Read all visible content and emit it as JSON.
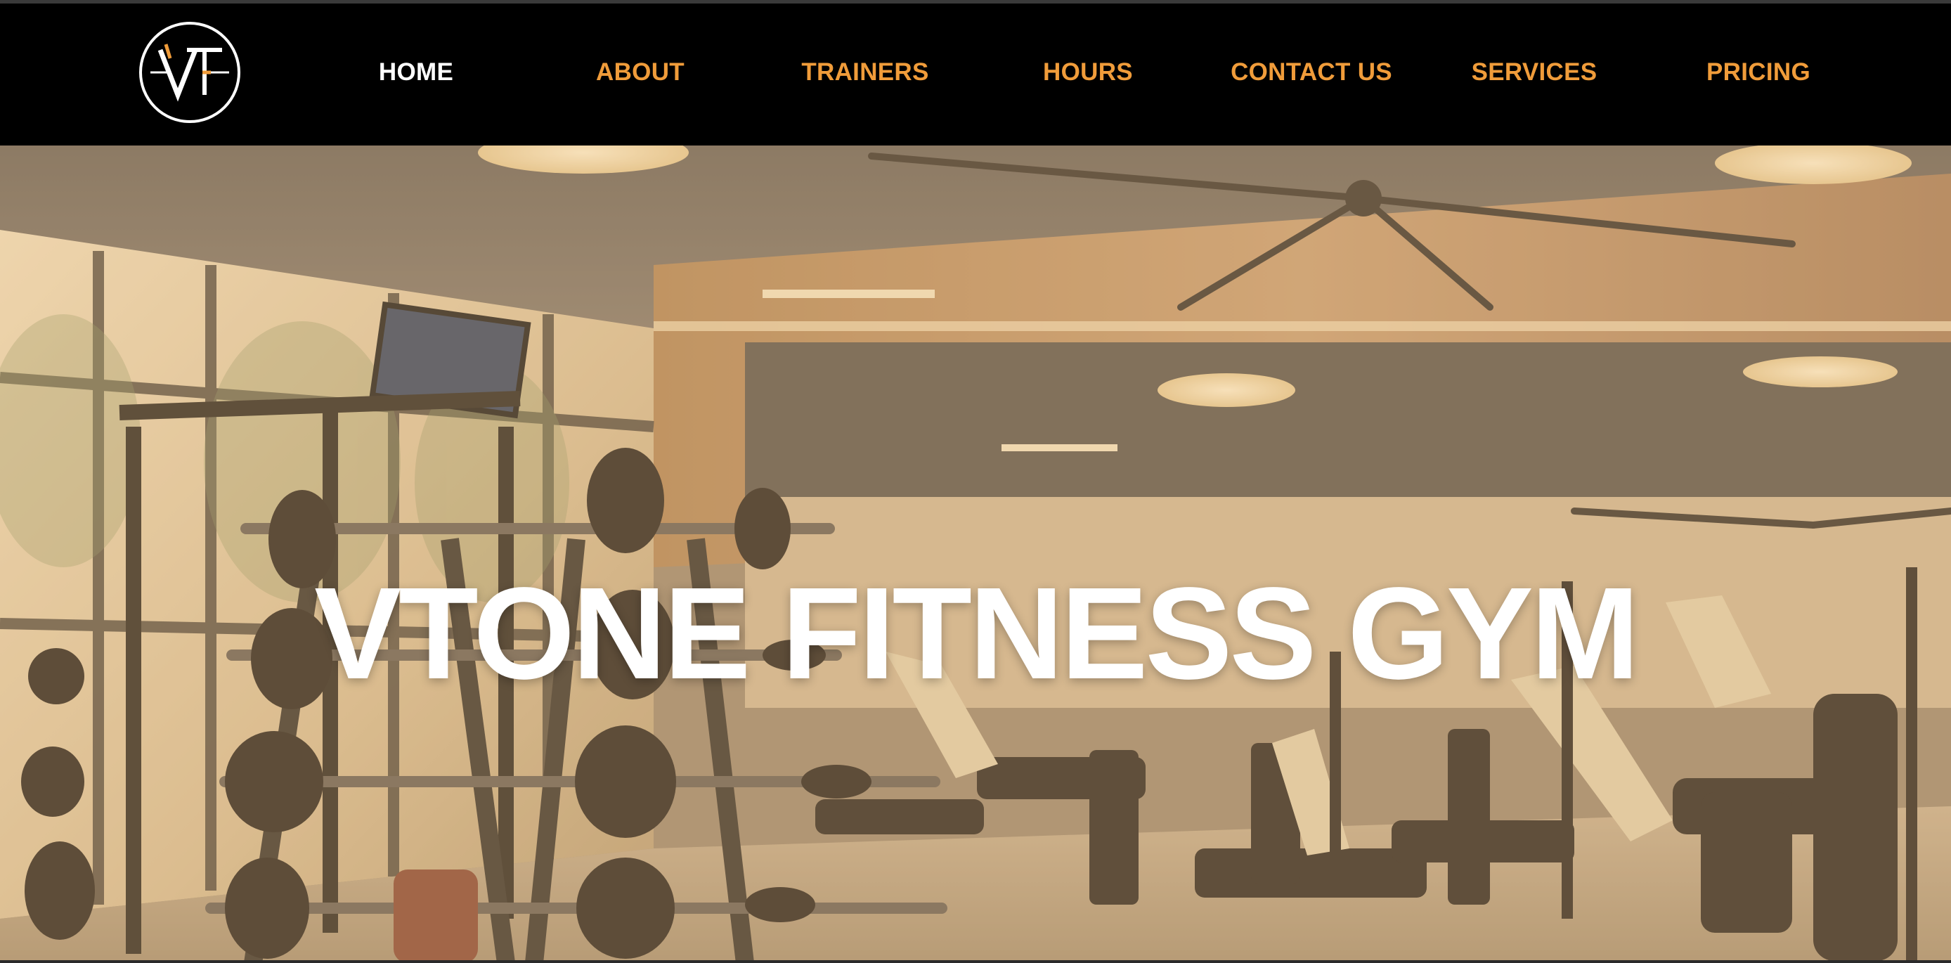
{
  "brand": {
    "logo_text": "VT",
    "logo_icon": "vt-monogram-logo-icon",
    "accent_color": "#f09c3a"
  },
  "nav": {
    "items": [
      {
        "label": "HOME",
        "active": true
      },
      {
        "label": "ABOUT",
        "active": false
      },
      {
        "label": "TRAINERS",
        "active": false
      },
      {
        "label": "HOURS",
        "active": false
      },
      {
        "label": "CONTACT US",
        "active": false
      },
      {
        "label": "SERVICES",
        "active": false
      },
      {
        "label": "PRICING",
        "active": false
      }
    ],
    "active_color": "#ffffff",
    "inactive_color": "#f09c3a"
  },
  "hero": {
    "title": "VTONE FITNESS GYM",
    "background_icon": "gym-interior-photo",
    "tint_color": "#e2b070"
  }
}
